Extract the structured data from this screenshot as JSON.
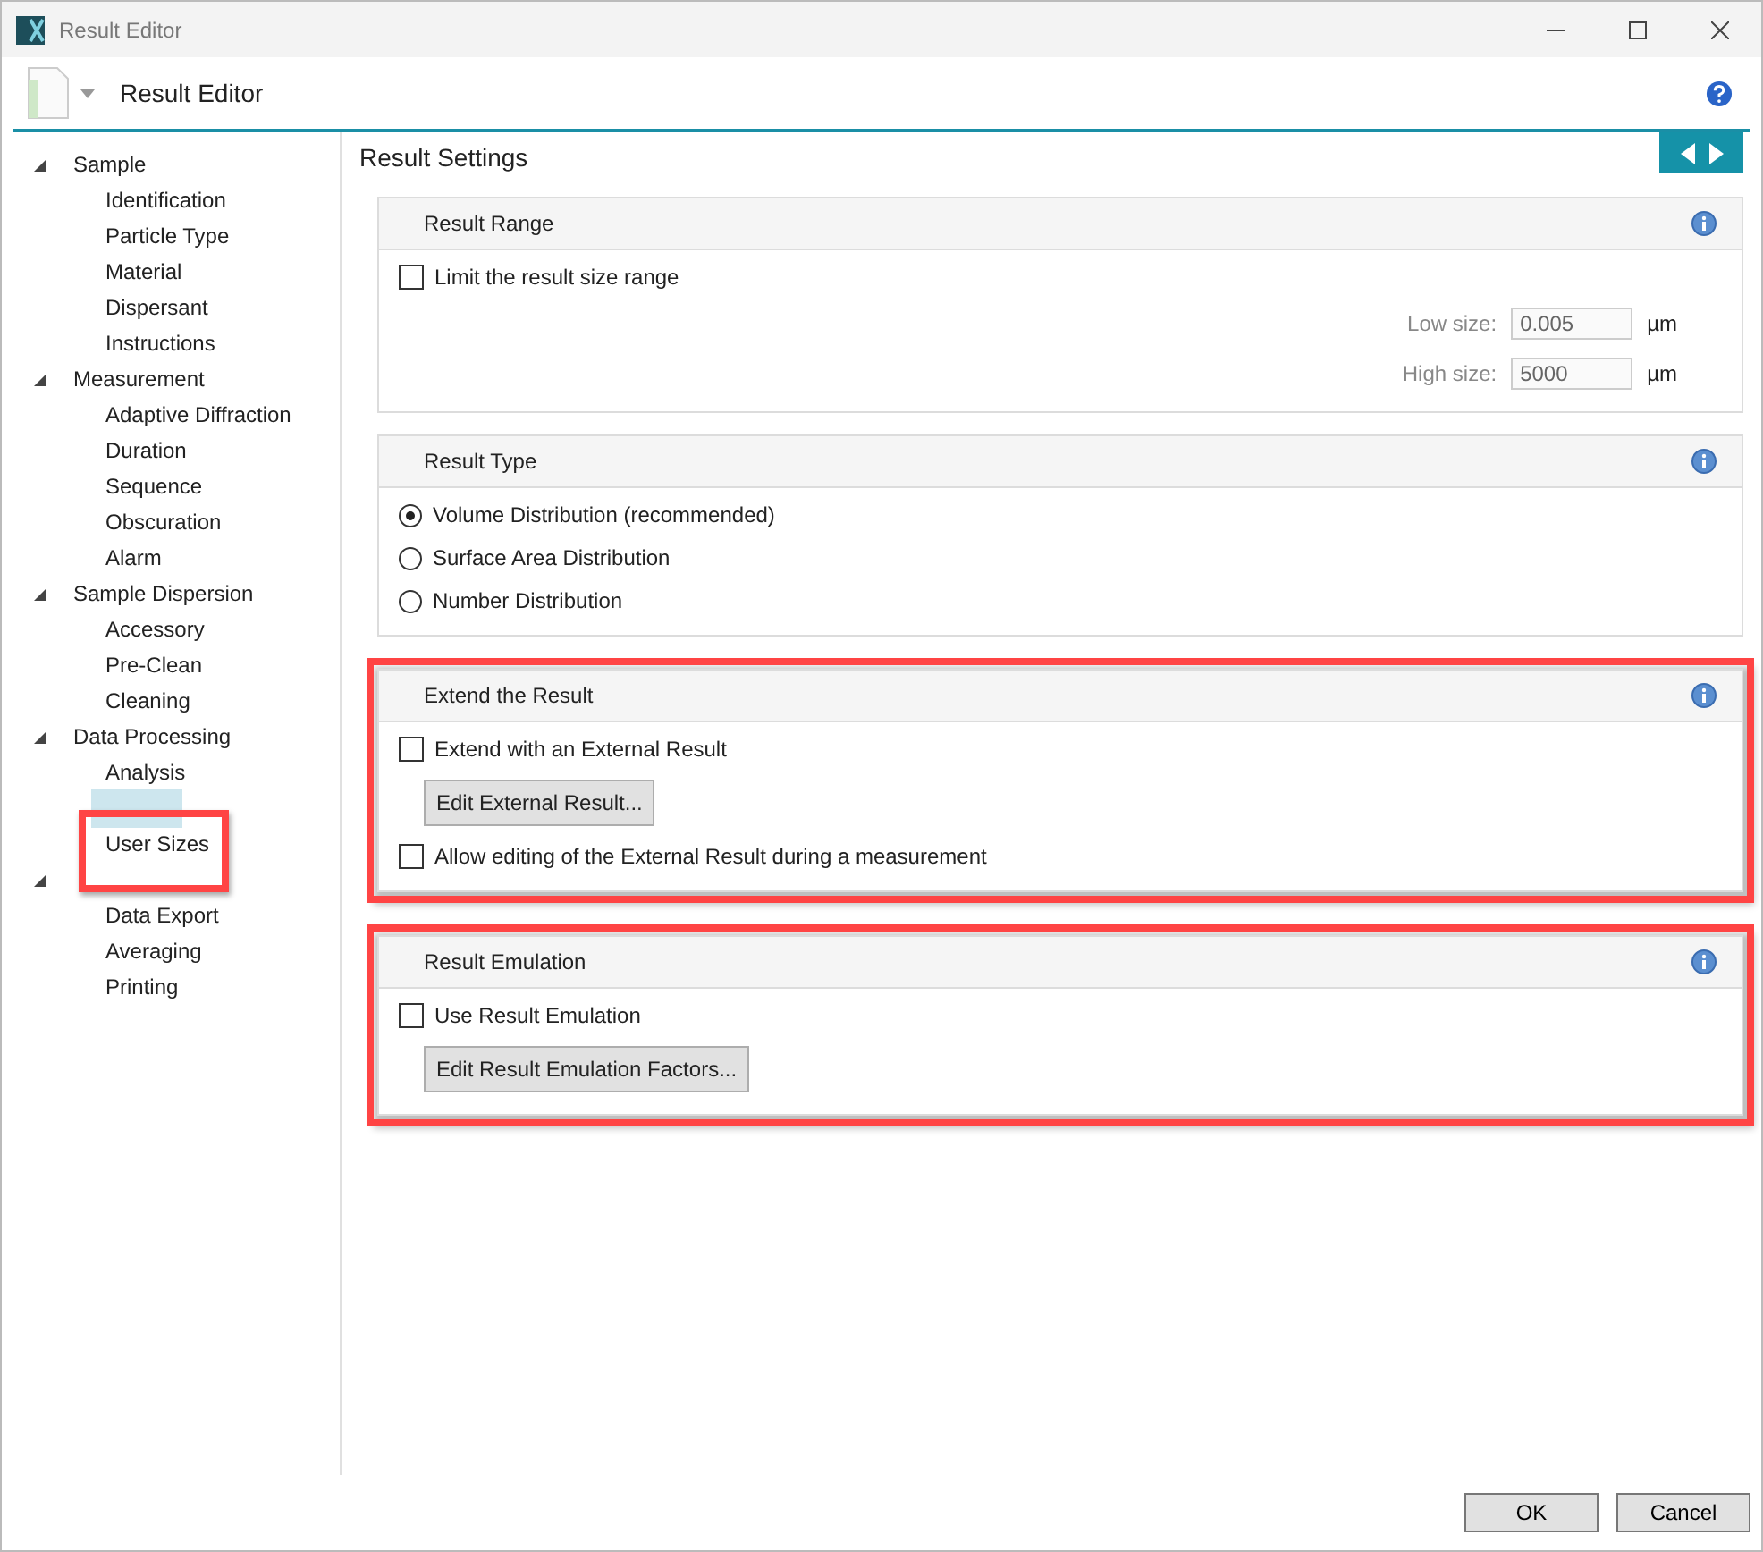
{
  "window": {
    "title": "Result Editor"
  },
  "header": {
    "title": "Result Editor"
  },
  "sidebar": {
    "groups": [
      {
        "label": "Sample",
        "expanded": true,
        "children": [
          {
            "label": "Identification",
            "selected": false
          },
          {
            "label": "Particle Type",
            "selected": false
          },
          {
            "label": "Material",
            "selected": false
          },
          {
            "label": "Dispersant",
            "selected": false
          },
          {
            "label": "Instructions",
            "selected": false
          }
        ]
      },
      {
        "label": "Measurement",
        "expanded": true,
        "children": [
          {
            "label": "Adaptive Diffraction",
            "selected": false
          },
          {
            "label": "Duration",
            "selected": false
          },
          {
            "label": "Sequence",
            "selected": false
          },
          {
            "label": "Obscuration",
            "selected": false
          },
          {
            "label": "Alarm",
            "selected": false
          }
        ]
      },
      {
        "label": "Sample Dispersion",
        "expanded": true,
        "children": [
          {
            "label": "Accessory",
            "selected": false
          },
          {
            "label": "Pre-Clean",
            "selected": false
          },
          {
            "label": "Cleaning",
            "selected": false
          }
        ]
      },
      {
        "label": "Data Processing",
        "expanded": true,
        "children": [
          {
            "label": "Analysis",
            "selected": false
          },
          {
            "selected": true
          },
          {
            "label": "User Sizes",
            "selected": false,
            "highlighted": true
          }
        ]
      },
      {
        "expanded": true,
        "children": [
          {
            "label": "Data Export",
            "selected": false
          },
          {
            "label": "Averaging",
            "selected": false
          },
          {
            "label": "Printing",
            "selected": false
          }
        ]
      }
    ]
  },
  "content": {
    "title": "Result Settings",
    "sections": [
      {
        "title": "Result Range",
        "highlighted": false,
        "items": [
          {
            "kind": "checkbox",
            "label": "Limit the result size range",
            "checked": false
          },
          {
            "kind": "field",
            "label": "Low size:",
            "value": "0.005",
            "unit": "µm",
            "disabled": true
          },
          {
            "kind": "field",
            "label": "High size:",
            "value": "5000",
            "unit": "µm",
            "disabled": true
          }
        ]
      },
      {
        "title": "Result Type",
        "highlighted": false,
        "items": [
          {
            "kind": "radio",
            "label": "Volume Distribution (recommended)",
            "selected": true
          },
          {
            "kind": "radio",
            "label": "Surface Area Distribution",
            "selected": false
          },
          {
            "kind": "radio",
            "label": "Number Distribution",
            "selected": false
          }
        ]
      },
      {
        "title": "Extend the Result",
        "highlighted": true,
        "items": [
          {
            "kind": "checkbox",
            "label": "Extend with an External Result",
            "checked": false
          },
          {
            "kind": "button",
            "label": "Edit External Result..."
          },
          {
            "kind": "checkbox",
            "label": "Allow editing of the External Result during a measurement",
            "checked": false
          }
        ]
      },
      {
        "title": "Result Emulation",
        "highlighted": true,
        "items": [
          {
            "kind": "checkbox",
            "label": "Use Result Emulation",
            "checked": false
          },
          {
            "kind": "button",
            "label": "Edit Result Emulation Factors..."
          }
        ]
      }
    ]
  },
  "footer": {
    "buttons": [
      "OK",
      "Cancel"
    ]
  }
}
